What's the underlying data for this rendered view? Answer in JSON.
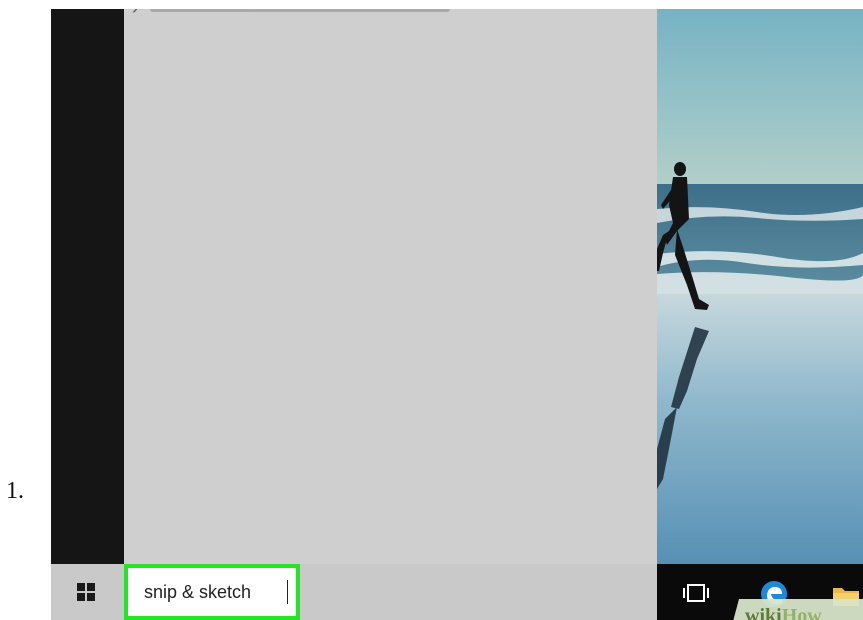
{
  "step": {
    "number_label": "1."
  },
  "start_menu": {
    "truncated_result_chevron": "›"
  },
  "taskbar": {
    "search": {
      "value": "snip & sketch",
      "highlight_color": "#22e722"
    },
    "icons": [
      "windows-logo-icon",
      "task-view-icon",
      "edge-browser-icon",
      "file-explorer-icon"
    ]
  },
  "watermark": {
    "text": "wikiHow"
  },
  "colors": {
    "start_panel": "#cfcfcf",
    "start_rail": "#151515",
    "taskbar": "#c9c9c9"
  }
}
